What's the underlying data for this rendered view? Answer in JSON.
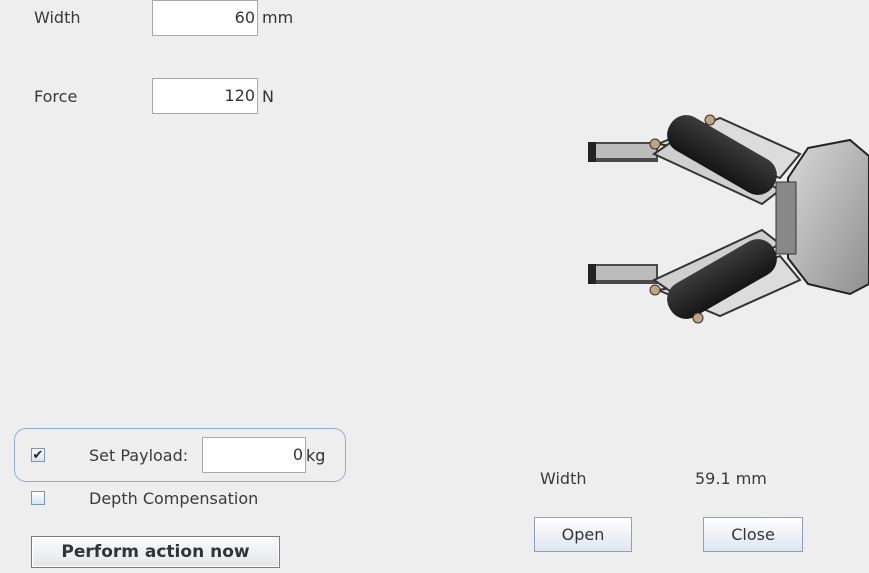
{
  "target": {
    "width_label": "Width",
    "width_value": "60",
    "width_unit": "mm",
    "force_label": "Force",
    "force_value": "120",
    "force_unit": "N"
  },
  "options": {
    "set_payload_label": "Set Payload:",
    "set_payload_checked": true,
    "payload_value": "0",
    "payload_unit": "kg",
    "depth_compensation_label": "Depth Compensation",
    "depth_compensation_checked": false,
    "checkmark": "✔"
  },
  "actions": {
    "perform_label": "Perform action now"
  },
  "status": {
    "width_label": "Width",
    "width_value": "59.1 mm"
  },
  "controls": {
    "open_label": "Open",
    "close_label": "Close"
  },
  "icons": {
    "gripper": "gripper-graphic"
  },
  "colors": {
    "background": "#eeeeee",
    "accent_border": "#8fb0d6",
    "button_border": "#8aa0bd"
  }
}
